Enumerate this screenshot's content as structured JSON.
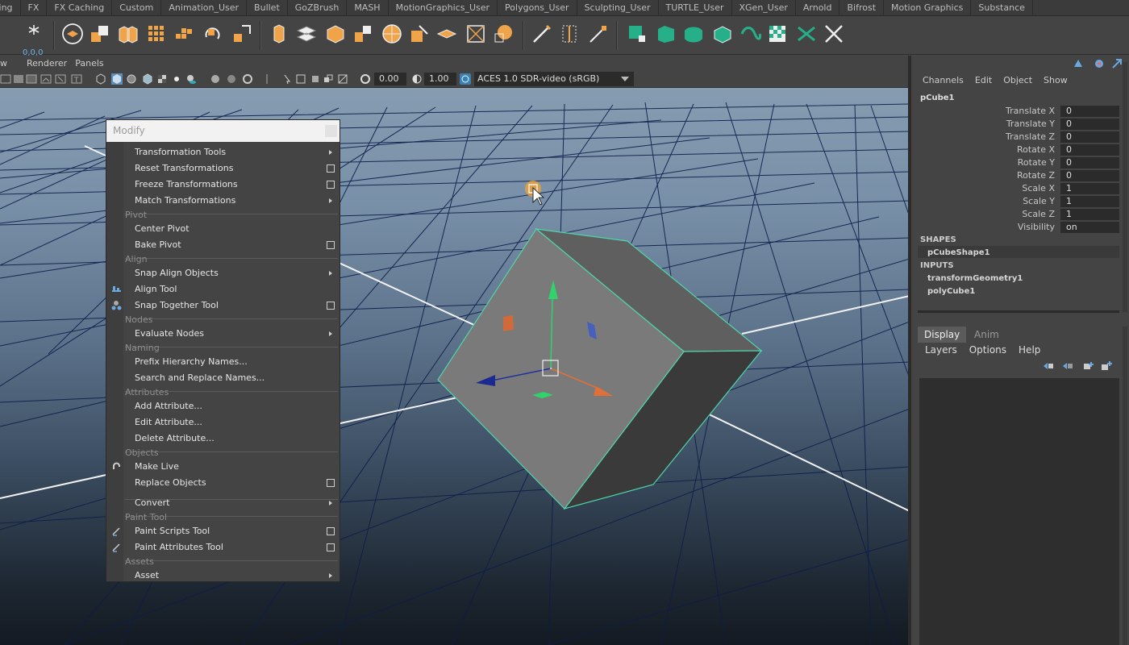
{
  "shelf_tabs": [
    "ring",
    "FX",
    "FX Caching",
    "Custom",
    "Animation_User",
    "Bullet",
    "GoZBrush",
    "MASH",
    "MotionGraphics_User",
    "Polygons_User",
    "Sculpting_User",
    "TURTLE_User",
    "XGen_User",
    "Arnold",
    "Bifrost",
    "Motion Graphics",
    "Substance"
  ],
  "shelf": {
    "coord_readout": "0,0,0"
  },
  "viewport": {
    "menu": [
      "w",
      "Renderer",
      "Panels"
    ],
    "exposure": "0.00",
    "gamma": "1.00",
    "colorspace": "ACES 1.0 SDR-video (sRGB)"
  },
  "modify_menu": {
    "title": "Modify",
    "items": [
      {
        "label": "Transformation Tools",
        "kind": "submenu"
      },
      {
        "label": "Reset Transformations",
        "kind": "option"
      },
      {
        "label": "Freeze Transformations",
        "kind": "option"
      },
      {
        "label": "Match Transformations",
        "kind": "submenu"
      },
      {
        "label": "Pivot",
        "kind": "header"
      },
      {
        "label": "Center Pivot",
        "kind": "item"
      },
      {
        "label": "Bake Pivot",
        "kind": "option"
      },
      {
        "label": "Align",
        "kind": "header"
      },
      {
        "label": "Snap Align Objects",
        "kind": "submenu"
      },
      {
        "label": "Align Tool",
        "kind": "item",
        "icon": "align-icon"
      },
      {
        "label": "Snap Together Tool",
        "kind": "option",
        "icon": "snap-together-icon"
      },
      {
        "label": "Nodes",
        "kind": "header"
      },
      {
        "label": "Evaluate Nodes",
        "kind": "submenu"
      },
      {
        "label": "Naming",
        "kind": "header"
      },
      {
        "label": "Prefix Hierarchy Names...",
        "kind": "item"
      },
      {
        "label": "Search and Replace Names...",
        "kind": "item"
      },
      {
        "label": "Attributes",
        "kind": "header"
      },
      {
        "label": "Add Attribute...",
        "kind": "item"
      },
      {
        "label": "Edit Attribute...",
        "kind": "item"
      },
      {
        "label": "Delete Attribute...",
        "kind": "item"
      },
      {
        "label": "Objects",
        "kind": "header"
      },
      {
        "label": "Make Live",
        "kind": "item",
        "icon": "magnet-icon"
      },
      {
        "label": "Replace Objects",
        "kind": "option"
      },
      {
        "label": "Convert",
        "kind": "submenu"
      },
      {
        "label": "Paint Tool",
        "kind": "header"
      },
      {
        "label": "Paint Scripts Tool",
        "kind": "option",
        "icon": "paint-brush-icon"
      },
      {
        "label": "Paint Attributes Tool",
        "kind": "option",
        "icon": "paint-brush-icon"
      },
      {
        "label": "Assets",
        "kind": "header"
      },
      {
        "label": "Asset",
        "kind": "submenu"
      }
    ]
  },
  "channel_box": {
    "menu": [
      "Channels",
      "Edit",
      "Object",
      "Show"
    ],
    "object": "pCube1",
    "attributes": [
      {
        "label": "Translate X",
        "value": "0"
      },
      {
        "label": "Translate Y",
        "value": "0"
      },
      {
        "label": "Translate Z",
        "value": "0"
      },
      {
        "label": "Rotate X",
        "value": "0"
      },
      {
        "label": "Rotate Y",
        "value": "0"
      },
      {
        "label": "Rotate Z",
        "value": "0"
      },
      {
        "label": "Scale X",
        "value": "1"
      },
      {
        "label": "Scale Y",
        "value": "1"
      },
      {
        "label": "Scale Z",
        "value": "1"
      },
      {
        "label": "Visibility",
        "value": "on"
      }
    ],
    "shapes_label": "SHAPES",
    "shape_node": "pCubeShape1",
    "inputs_label": "INPUTS",
    "input_nodes": [
      "transformGeometry1",
      "polyCube1"
    ]
  },
  "layer_editor": {
    "tabs": [
      "Display",
      "Anim"
    ],
    "active_tab": "Display",
    "menu": [
      "Layers",
      "Options",
      "Help"
    ]
  },
  "colors": {
    "selection_wire": "#4fd6a8",
    "move_y": "#2fd36a",
    "move_x": "#e0703a",
    "move_z": "#2030a0",
    "accent_orange": "#e6a040"
  }
}
